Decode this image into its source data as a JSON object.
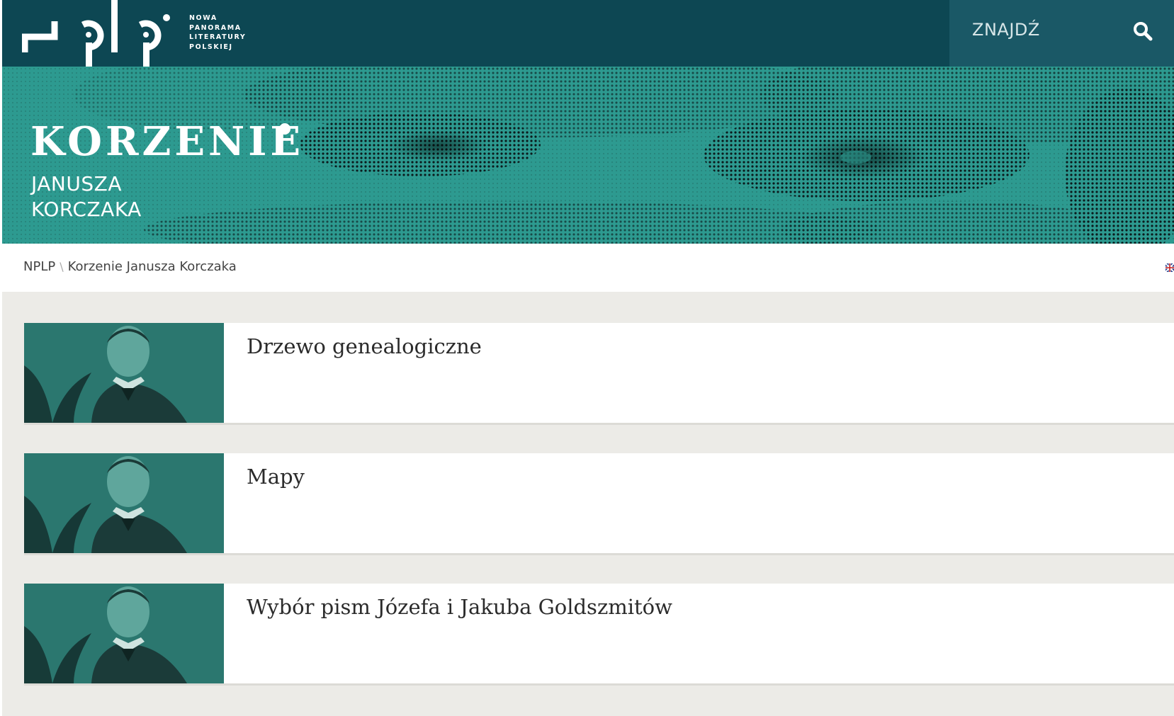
{
  "header": {
    "logo_lines": [
      "NOWA",
      "PANORAMA",
      "LITERATURY",
      "POLSKIEJ"
    ],
    "search_label": "ZNAJDŹ",
    "search_icon": "search-icon"
  },
  "banner": {
    "title": "KORZENIE",
    "subtitle_lines": [
      "JANUSZA",
      "KORCZAKA"
    ]
  },
  "breadcrumb": {
    "items": [
      "NPLP",
      "Korzenie Janusza Korczaka"
    ],
    "separator": "\\"
  },
  "language_icon": "uk-flag-icon",
  "list": {
    "items": [
      {
        "title": "Drzewo genealogiczne"
      },
      {
        "title": "Mapy"
      },
      {
        "title": "Wybór pism Józefa i Jakuba Goldszmitów"
      }
    ]
  },
  "colors": {
    "navbar": "#0d4753",
    "search_box": "#1a5866",
    "banner_teal": "#2d9a90",
    "page_background": "#ecebe7"
  }
}
